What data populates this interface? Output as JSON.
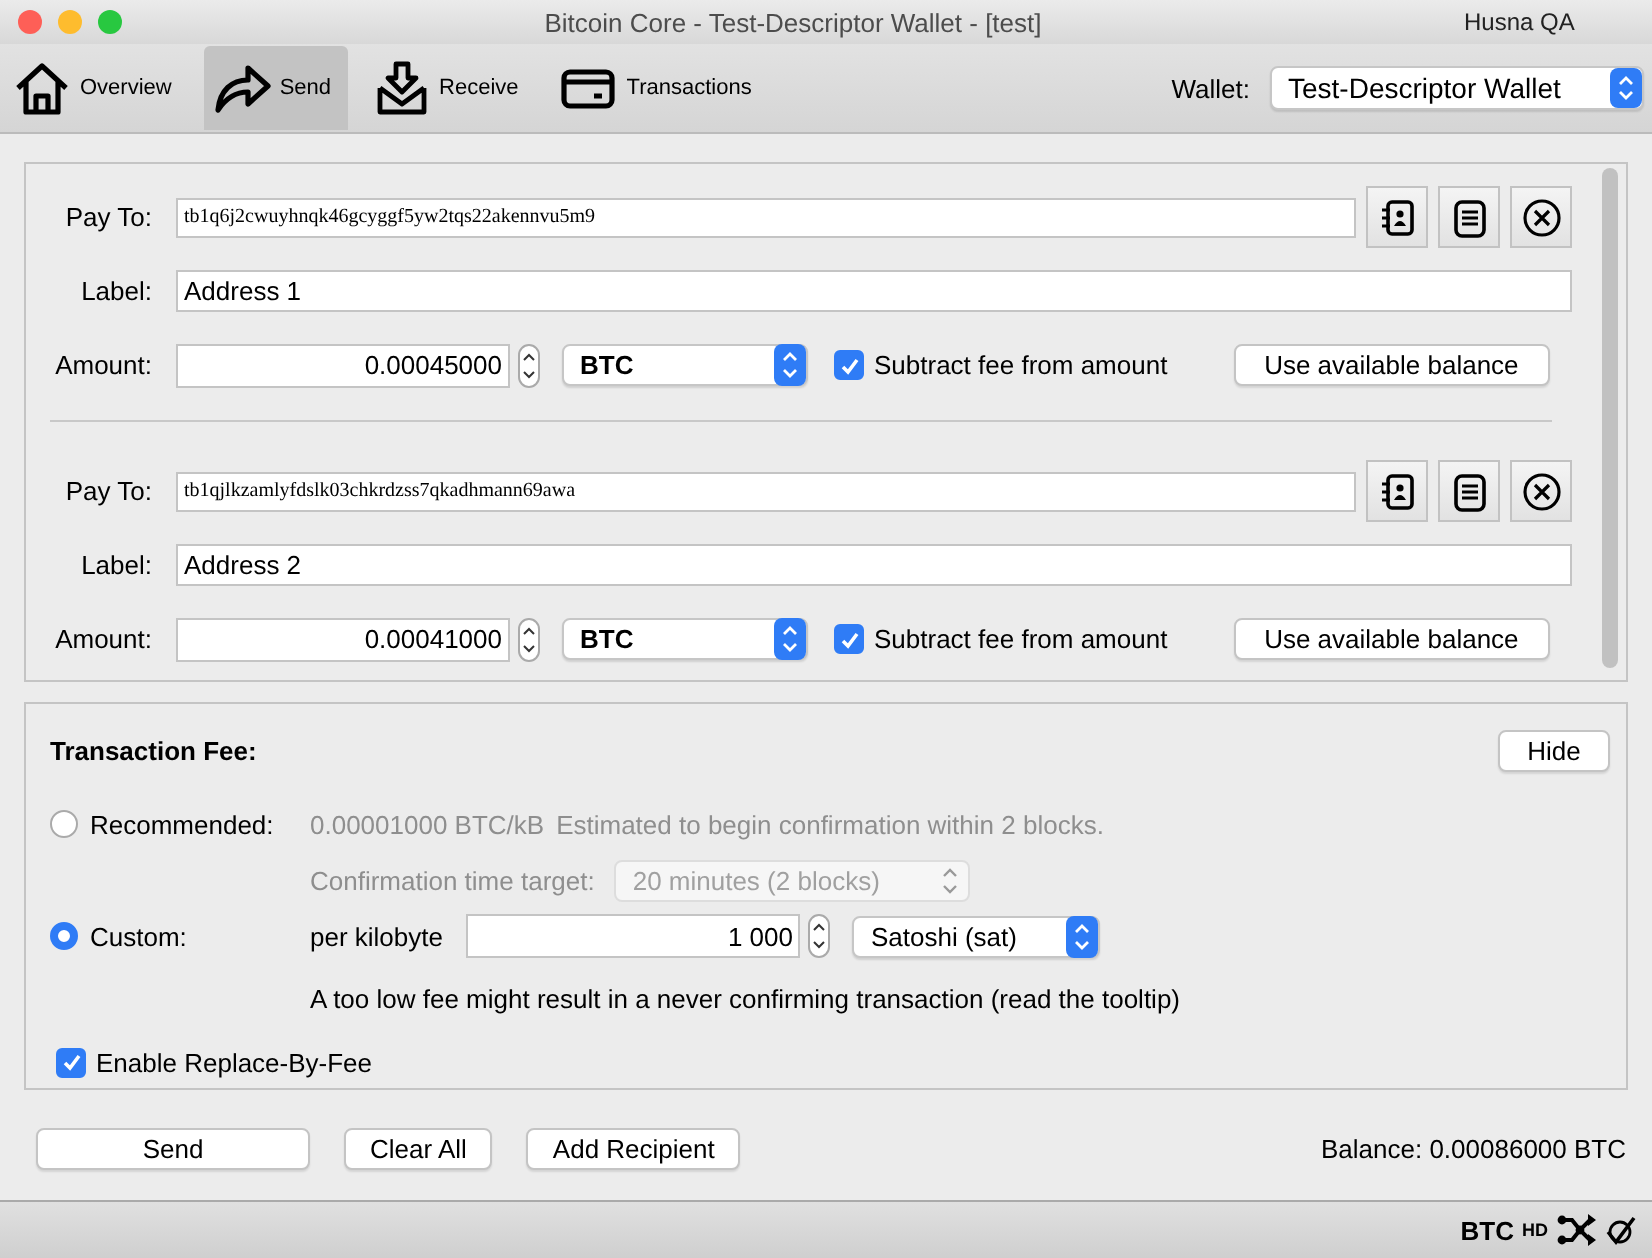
{
  "window": {
    "title": "Bitcoin Core - Test-Descriptor Wallet - [test]",
    "user": "Husna QA"
  },
  "tabs": [
    {
      "label": "Overview",
      "selected": false
    },
    {
      "label": "Send",
      "selected": true
    },
    {
      "label": "Receive",
      "selected": false
    },
    {
      "label": "Transactions",
      "selected": false
    }
  ],
  "wallet": {
    "label": "Wallet:",
    "value": "Test-Descriptor Wallet"
  },
  "recipients": [
    {
      "pay_to_label": "Pay To:",
      "address": "tb1q6j2cwuyhnqk46gcyggf5yw2tqs22akennvu5m9",
      "label_label": "Label:",
      "label": "Address 1",
      "amount_label": "Amount:",
      "amount": "0.00045000",
      "unit": "BTC",
      "subtract_fee": {
        "label": "Subtract fee from amount",
        "checked": true
      },
      "use_balance": "Use available balance"
    },
    {
      "pay_to_label": "Pay To:",
      "address": "tb1qjlkzamlyfdslk03chkrdzss7qkadhmann69awa",
      "label_label": "Label:",
      "label": "Address 2",
      "amount_label": "Amount:",
      "amount": "0.00041000",
      "unit": "BTC",
      "subtract_fee": {
        "label": "Subtract fee from amount",
        "checked": true
      },
      "use_balance": "Use available balance"
    }
  ],
  "fee": {
    "title": "Transaction Fee:",
    "hide": "Hide",
    "recommended": {
      "label": "Recommended:",
      "selected": false,
      "rate": "0.00001000 BTC/kB",
      "estimate": "Estimated to begin confirmation within 2 blocks.",
      "target_label": "Confirmation time target:",
      "target": "20 minutes (2 blocks)",
      "disabled": true
    },
    "custom": {
      "label": "Custom:",
      "selected": true,
      "per_label": "per kilobyte",
      "value": "1 000",
      "unit": "Satoshi (sat)",
      "warning": "A too low fee might result in a never confirming transaction (read the tooltip)"
    },
    "rbf": {
      "label": "Enable Replace-By-Fee",
      "checked": true
    }
  },
  "buttons": [
    "Send",
    "Clear All",
    "Add Recipient"
  ],
  "balance": "Balance: 0.00086000 BTC",
  "status_bar": {
    "unit": "BTC",
    "hd": "HD"
  }
}
